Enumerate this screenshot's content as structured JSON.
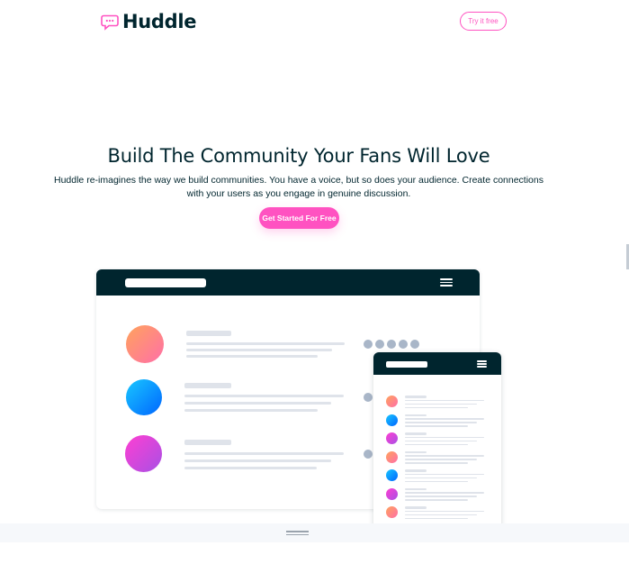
{
  "header": {
    "brand": "Huddle",
    "logo_icon": "chat-bubble-icon",
    "try_button_label": "Try it free"
  },
  "hero": {
    "title": "Build The Community Your Fans Will Love",
    "description": "Huddle re-imagines the way we build communities. You have a voice, but so does your audience. Create connections with your users as you engage in genuine discussion.",
    "cta_label": "Get Started For Free"
  },
  "illustration": {
    "desktop_avatars": [
      "orange-gradient-avatar",
      "blue-gradient-avatar",
      "purple-gradient-avatar"
    ],
    "mobile_avatars": [
      "orange",
      "blue",
      "purple",
      "orange",
      "blue",
      "purple",
      "orange"
    ]
  },
  "colors": {
    "accent": "#ff52c1",
    "dark": "#00252e",
    "placeholder": "#dfe3ea",
    "dot": "#a9b6c8"
  }
}
